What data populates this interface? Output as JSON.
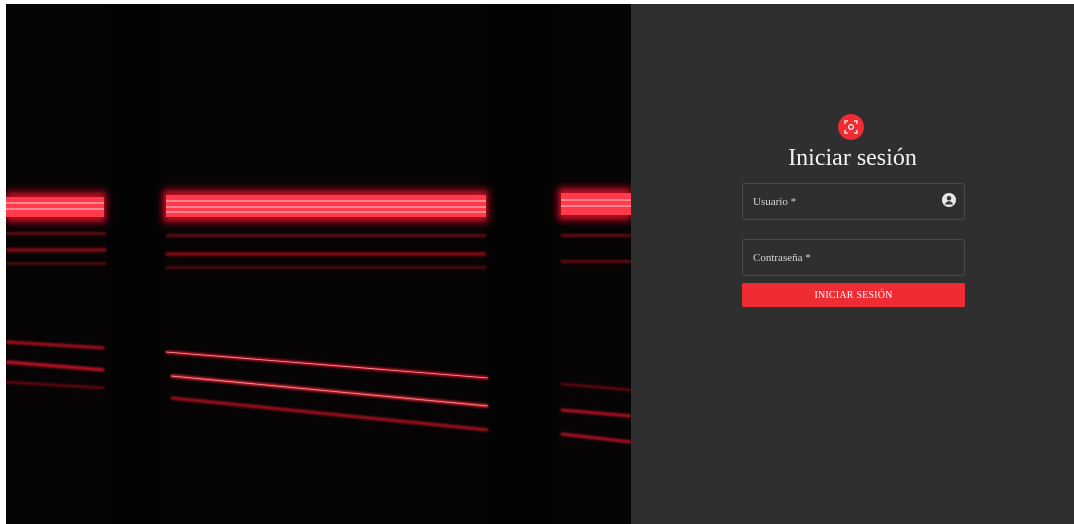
{
  "login": {
    "title": "Iniciar sesión",
    "username_label": "Usuario *",
    "password_label": "Contraseña *",
    "submit_label": "INICIAR SESIÓN"
  },
  "icons": {
    "logo": "scan-icon",
    "username_adornment": "user-badge-icon"
  },
  "colors": {
    "accent": "#ef2b33",
    "panel_background": "#2f2f2f",
    "hero_background": "#050404"
  }
}
